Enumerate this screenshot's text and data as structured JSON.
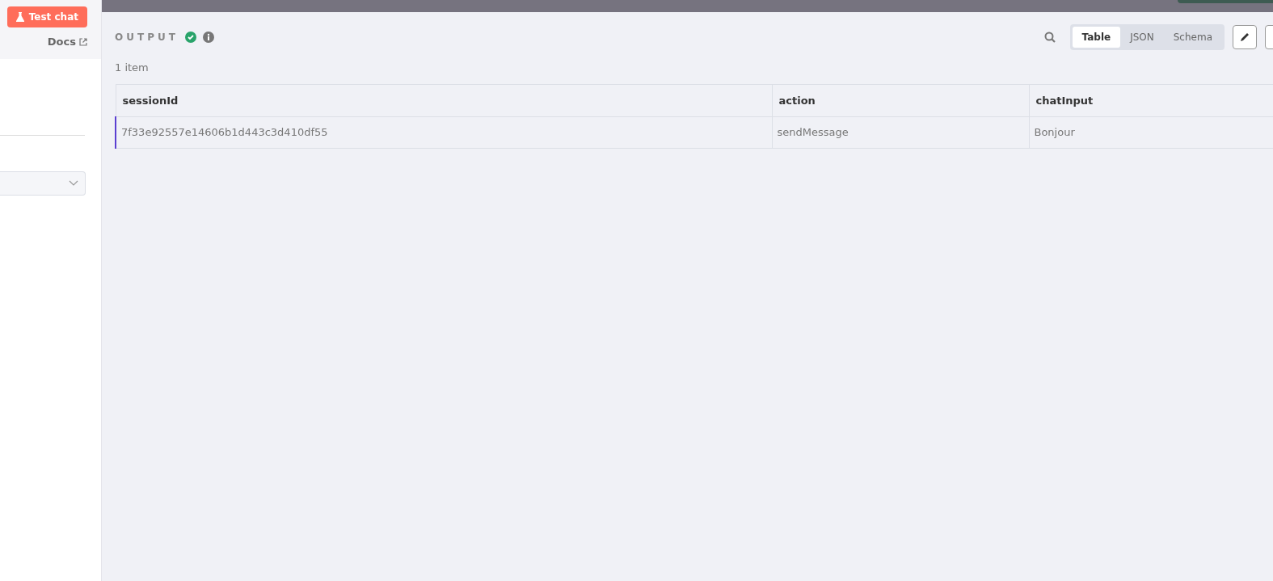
{
  "left_panel": {
    "test_chat_button": "Test chat",
    "docs_link": "Docs"
  },
  "output": {
    "title": "OUTPUT",
    "succeeded": true,
    "item_count": "1 item",
    "view_tabs": [
      {
        "label": "Table",
        "selected": true
      },
      {
        "label": "JSON",
        "selected": false
      },
      {
        "label": "Schema",
        "selected": false
      }
    ],
    "table": {
      "columns": [
        "sessionId",
        "action",
        "chatInput"
      ],
      "rows": [
        [
          "7f33e92557e14606b1d443c3d410df55",
          "sendMessage",
          "Bonjour"
        ]
      ]
    }
  }
}
